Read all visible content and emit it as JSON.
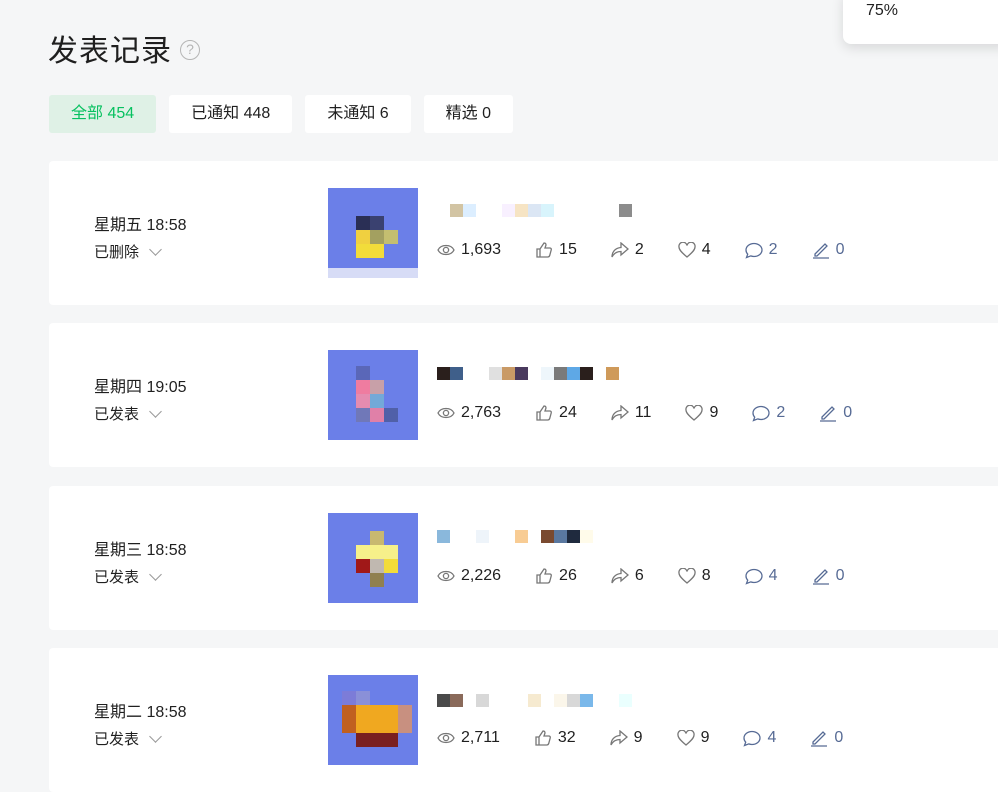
{
  "page": {
    "title": "发表记录",
    "help_icon": "question-circle-icon"
  },
  "popup": {
    "zoom": "75%"
  },
  "tabs": [
    {
      "label": "全部 454",
      "active": true
    },
    {
      "label": "已通知 448",
      "active": false
    },
    {
      "label": "未通知 6",
      "active": false
    },
    {
      "label": "精选 0",
      "active": false
    }
  ],
  "posts": [
    {
      "date": "星期五 18:58",
      "status": "已删除",
      "stats": {
        "views": "1,693",
        "likes": "15",
        "shares": "2",
        "favorites": "4",
        "comments": "2",
        "notes": "0"
      }
    },
    {
      "date": "星期四 19:05",
      "status": "已发表",
      "stats": {
        "views": "2,763",
        "likes": "24",
        "shares": "11",
        "favorites": "9",
        "comments": "2",
        "notes": "0"
      }
    },
    {
      "date": "星期三 18:58",
      "status": "已发表",
      "stats": {
        "views": "2,226",
        "likes": "26",
        "shares": "6",
        "favorites": "8",
        "comments": "4",
        "notes": "0"
      }
    },
    {
      "date": "星期二 18:58",
      "status": "已发表",
      "stats": {
        "views": "2,711",
        "likes": "32",
        "shares": "9",
        "favorites": "9",
        "comments": "4",
        "notes": "0"
      }
    }
  ],
  "colors": {
    "accent": "#07c160",
    "tab_active_bg": "#dff1e6",
    "link": "#576b95",
    "thumb_bg": "#6b7fe8"
  }
}
